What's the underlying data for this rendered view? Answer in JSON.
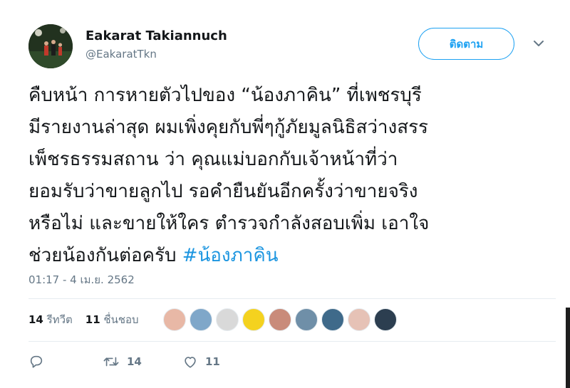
{
  "user": {
    "display_name": "Eakarat Takiannuch",
    "handle": "@EakaratTkn"
  },
  "follow_button": {
    "label": "ติดตาม"
  },
  "tweet": {
    "lines": [
      "คืบหน้า การหายตัวไปของ “น้องภาคิน” ที่เพชรบุรี",
      "มีรายงานล่าสุด ผมเพิ่งคุยกับพี่ๆกู้ภัยมูลนิธิสว่างสรร",
      "เพ็ชรธรรมสถาน ว่า คุณแม่บอกกับเจ้าหน้าที่ว่า",
      "ยอมรับว่าขายลูกไป รอคำยืนยันอีกครั้งว่าขายจริง",
      "หรือไม่ และขายให้ใคร ตำรวจกำลังสอบเพิ่ม เอาใจ"
    ],
    "last_line_text": "ช่วยน้องกันต่อครับ ",
    "hashtag": "#น้องภาคิน",
    "timestamp": "01:17 - 4 เม.ย. 2562"
  },
  "stats": {
    "retweets_count": "14",
    "retweets_label": "รีทวีต",
    "likes_count": "11",
    "likes_label": "ชื่นชอบ"
  },
  "likers": [
    {
      "color": "#e8b8a6"
    },
    {
      "color": "#7fa7c9"
    },
    {
      "color": "#d9d9d9"
    },
    {
      "color": "#f4d21f"
    },
    {
      "color": "#c98b7a"
    },
    {
      "color": "#6f8fa8"
    },
    {
      "color": "#3f6a8a"
    },
    {
      "color": "#e6c2b6"
    },
    {
      "color": "#2c3e50"
    }
  ],
  "actions": {
    "reply_icon": "reply-icon",
    "retweet_icon": "retweet-icon",
    "retweet_count": "14",
    "like_icon": "heart-icon",
    "like_count": "11"
  },
  "colors": {
    "accent": "#1da1f2",
    "hashtag": "#1b95e0",
    "muted": "#657786",
    "text": "#14171a"
  }
}
